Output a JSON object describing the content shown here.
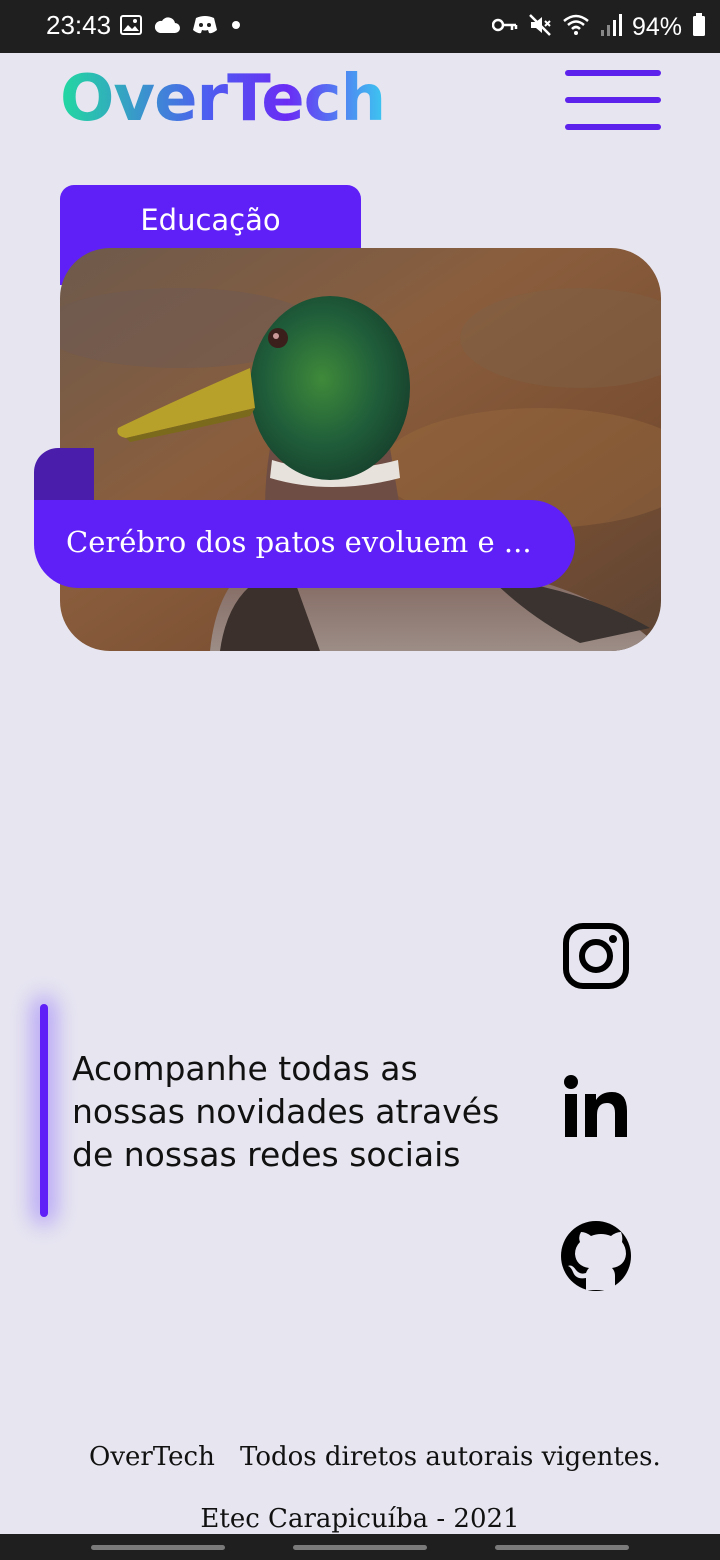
{
  "status_bar": {
    "time": "23:43",
    "battery": "94%",
    "icons_left": [
      "image-icon",
      "cloud-icon",
      "discord-icon",
      "dot-icon"
    ],
    "icons_right": [
      "key-icon",
      "mute-icon",
      "wifi-icon",
      "signal-icon",
      "battery-icon"
    ]
  },
  "header": {
    "logo": "OverTech",
    "menu_icon": "hamburger-menu-icon"
  },
  "card": {
    "category": "Educação",
    "title": "Cerébro dos patos evoluem e ..."
  },
  "social": {
    "text": "Acompanhe todas as nossas novidades através de nossas redes sociais",
    "links": [
      "instagram-icon",
      "linkedin-icon",
      "github-icon"
    ]
  },
  "footer": {
    "brand": "OverTech",
    "rights": "Todos diretos autorais vigentes.",
    "school": "Etec Carapicuíba - 2021"
  },
  "colors": {
    "accent": "#5f1ff7",
    "background": "#e7e6f0"
  }
}
